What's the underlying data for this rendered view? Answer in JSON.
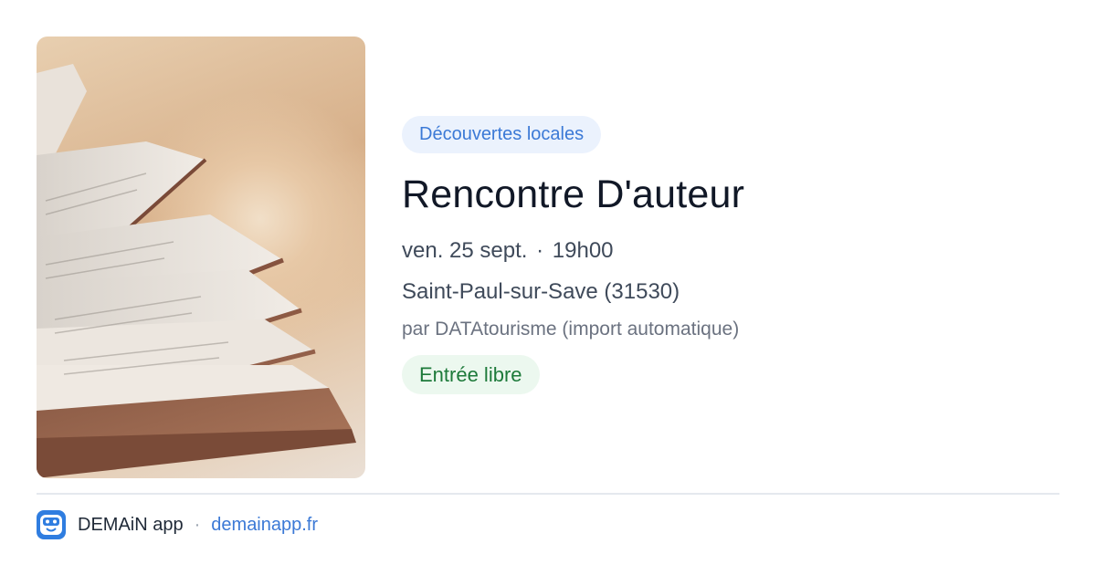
{
  "event": {
    "category": "Découvertes locales",
    "title": "Rencontre D'auteur",
    "date": "ven. 25 sept.",
    "date_separator": "·",
    "time": "19h00",
    "location": "Saint-Paul-sur-Save (31530)",
    "organizer": "par DATAtourisme (import automatique)",
    "price": "Entrée libre"
  },
  "footer": {
    "app_name": "DEMAiN app",
    "separator": "·",
    "link": "demainapp.fr"
  },
  "colors": {
    "accent": "#3b79d6",
    "category_bg": "#ebf2fd",
    "price_text": "#1d7a3a",
    "price_bg": "#ecf8ef",
    "title": "#111827"
  },
  "icons": {
    "app": "demain-app-icon"
  }
}
